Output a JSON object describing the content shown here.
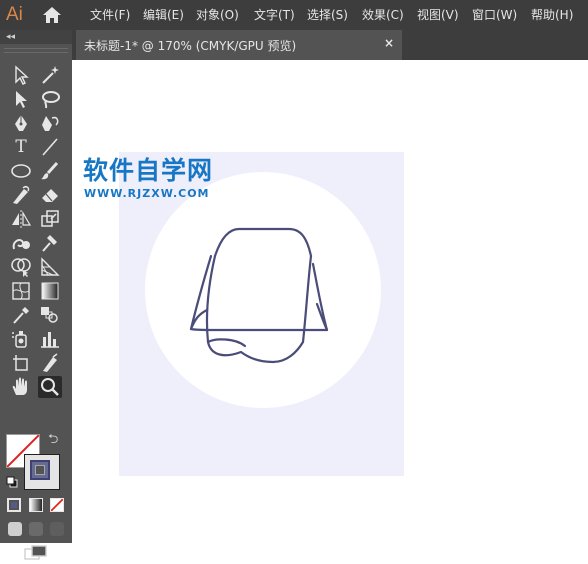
{
  "app": {
    "logo": "Ai"
  },
  "menu": [
    {
      "label": "文件(F)"
    },
    {
      "label": "编辑(E)"
    },
    {
      "label": "对象(O)"
    },
    {
      "label": "文字(T)"
    },
    {
      "label": "选择(S)"
    },
    {
      "label": "效果(C)"
    },
    {
      "label": "视图(V)"
    },
    {
      "label": "窗口(W)"
    },
    {
      "label": "帮助(H)"
    }
  ],
  "toolbar": {
    "collapse": "◂◂",
    "type_tool_glyph": "T",
    "icons": [
      "selection-tool",
      "magic-wand-tool",
      "direct-selection-tool",
      "lasso-tool",
      "pen-tool",
      "curvature-tool",
      "type-tool",
      "line-segment-tool",
      "ellipse-tool",
      "paintbrush-tool",
      "shaper-tool",
      "eraser-tool",
      "reflect-tool",
      "scale-tool",
      "warp-tool",
      "puppet-warp-tool",
      "shape-builder-tool",
      "perspective-grid-tool",
      "mesh-tool",
      "gradient-tool",
      "eyedropper-tool",
      "blend-tool",
      "symbol-sprayer-tool",
      "column-graph-tool",
      "artboard-tool",
      "slice-tool",
      "hand-tool",
      "zoom-tool"
    ],
    "active_tool": "zoom-tool",
    "fill": "none",
    "stroke_color": "#4a4c7a"
  },
  "document": {
    "tab_title": "未标题-1* @ 170% (CMYK/GPU 预览)",
    "close": "×"
  },
  "artwork": {
    "watermark_title": "软件自学网",
    "watermark_url": "WWW.RJZXW.COM",
    "background_color": "#efeffb",
    "circle_color": "#ffffff",
    "line_color": "#4a4c7a"
  }
}
